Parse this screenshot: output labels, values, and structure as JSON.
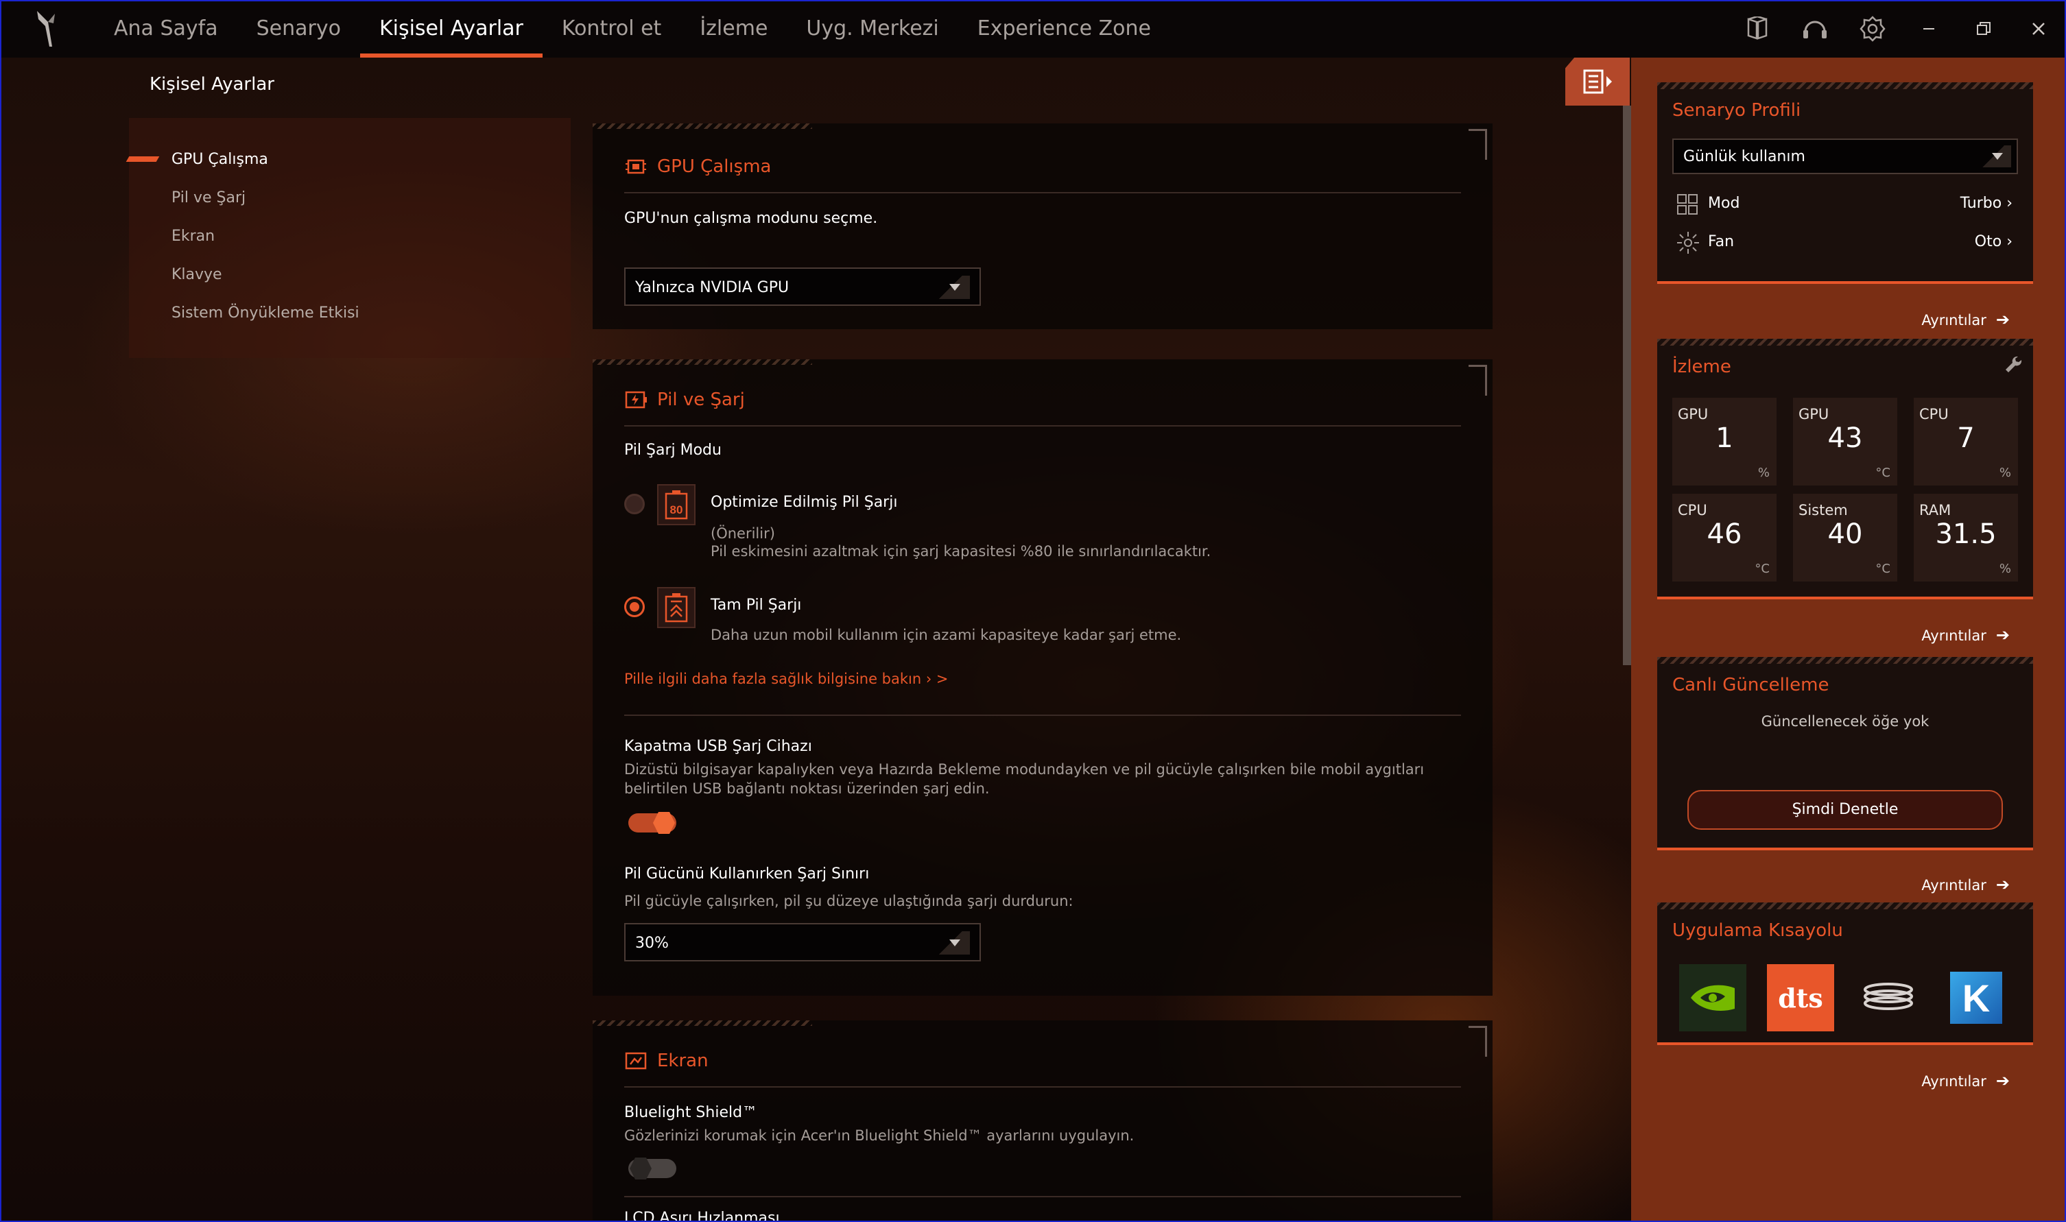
{
  "nav": {
    "tabs": [
      "Ana Sayfa",
      "Senaryo",
      "Kişisel Ayarlar",
      "Kontrol et",
      "İzleme",
      "Uyg. Merkezi",
      "Experience Zone"
    ],
    "active_tab": "Kişisel Ayarlar",
    "icons": [
      "book-icon",
      "headset-icon",
      "gear-icon"
    ],
    "window_controls": [
      "minimize-icon",
      "restore-icon",
      "close-icon"
    ]
  },
  "page_title": "Kişisel Ayarlar",
  "sidemenu": {
    "items": [
      "GPU Çalışma",
      "Pil ve Şarj",
      "Ekran",
      "Klavye",
      "Sistem Önyükleme Etkisi"
    ],
    "active": "GPU Çalışma"
  },
  "gpu": {
    "title": "GPU Çalışma",
    "description": "GPU'nun çalışma modunu seçme.",
    "select_value": "Yalnızca NVIDIA GPU"
  },
  "battery": {
    "title": "Pil ve Şarj",
    "mode_label": "Pil Şarj Modu",
    "opt1_title": "Optimize Edilmiş Pil Şarjı",
    "opt1_icon_text": "80",
    "opt1_line1": "(Önerilir)",
    "opt1_line2": "Pil eskimesini azaltmak için şarj kapasitesi %80 ile sınırlandırılacaktır.",
    "opt2_title": "Tam Pil Şarjı",
    "opt2_line1": "Daha uzun mobil kullanım için azami kapasiteye kadar şarj etme.",
    "selected_option": "Tam Pil Şarjı",
    "health_link": "Pille ilgili daha fazla sağlık bilgisine bakın ›  >",
    "usb_title": "Kapatma USB Şarj Cihazı",
    "usb_line1": "Dizüstü bilgisayar kapalıyken veya Hazırda Bekleme modundayken ve pil gücüyle çalışırken bile mobil aygıtları",
    "usb_line2": "belirtilen USB bağlantı noktası üzerinden şarj edin.",
    "usb_toggle_on": true,
    "limit_title": "Pil Gücünü Kullanırken Şarj Sınırı",
    "limit_desc": "Pil gücüyle çalışırken, pil şu düzeye ulaştığında şarjı durdurun:",
    "limit_value": "30%"
  },
  "display": {
    "title": "Ekran",
    "bluelight_title": "Bluelight Shield™",
    "bluelight_desc": "Gözlerinizi korumak için Acer'ın Bluelight Shield™ ayarlarını uygulayın.",
    "bluelight_toggle_on": false,
    "lcd_title": "LCD Aşırı Hızlanması"
  },
  "right": {
    "scenario": {
      "title": "Senaryo Profili",
      "select_value": "Günlük kullanım",
      "mode_label": "Mod",
      "mode_value": "Turbo  ›",
      "fan_label": "Fan",
      "fan_value": "Oto  ›",
      "details": "Ayrıntılar"
    },
    "monitor": {
      "title": "İzleme",
      "metrics": [
        {
          "label": "GPU",
          "value": "1",
          "unit": "%"
        },
        {
          "label": "GPU",
          "value": "43",
          "unit": "°C"
        },
        {
          "label": "CPU",
          "value": "7",
          "unit": "%"
        },
        {
          "label": "CPU",
          "value": "46",
          "unit": "°C"
        },
        {
          "label": "Sistem",
          "value": "40",
          "unit": "°C"
        },
        {
          "label": "RAM",
          "value": "31.5",
          "unit": "%"
        }
      ],
      "details": "Ayrıntılar"
    },
    "live_update": {
      "title": "Canlı Güncelleme",
      "empty": "Güncellenecek öğe yok",
      "button": "Şimdi Denetle",
      "details": "Ayrıntılar"
    },
    "shortcuts": {
      "title": "Uygulama Kısayolu",
      "apps": [
        "nvidia-icon",
        "dts-icon",
        "acer-coil-icon",
        "k-app-icon"
      ],
      "dts_label": "dts",
      "k_label": "K",
      "details": "Ayrıntılar"
    }
  },
  "colors": {
    "accent": "#e8562a",
    "panel": "#7a2e14",
    "nav_bg": "#0a0606"
  }
}
